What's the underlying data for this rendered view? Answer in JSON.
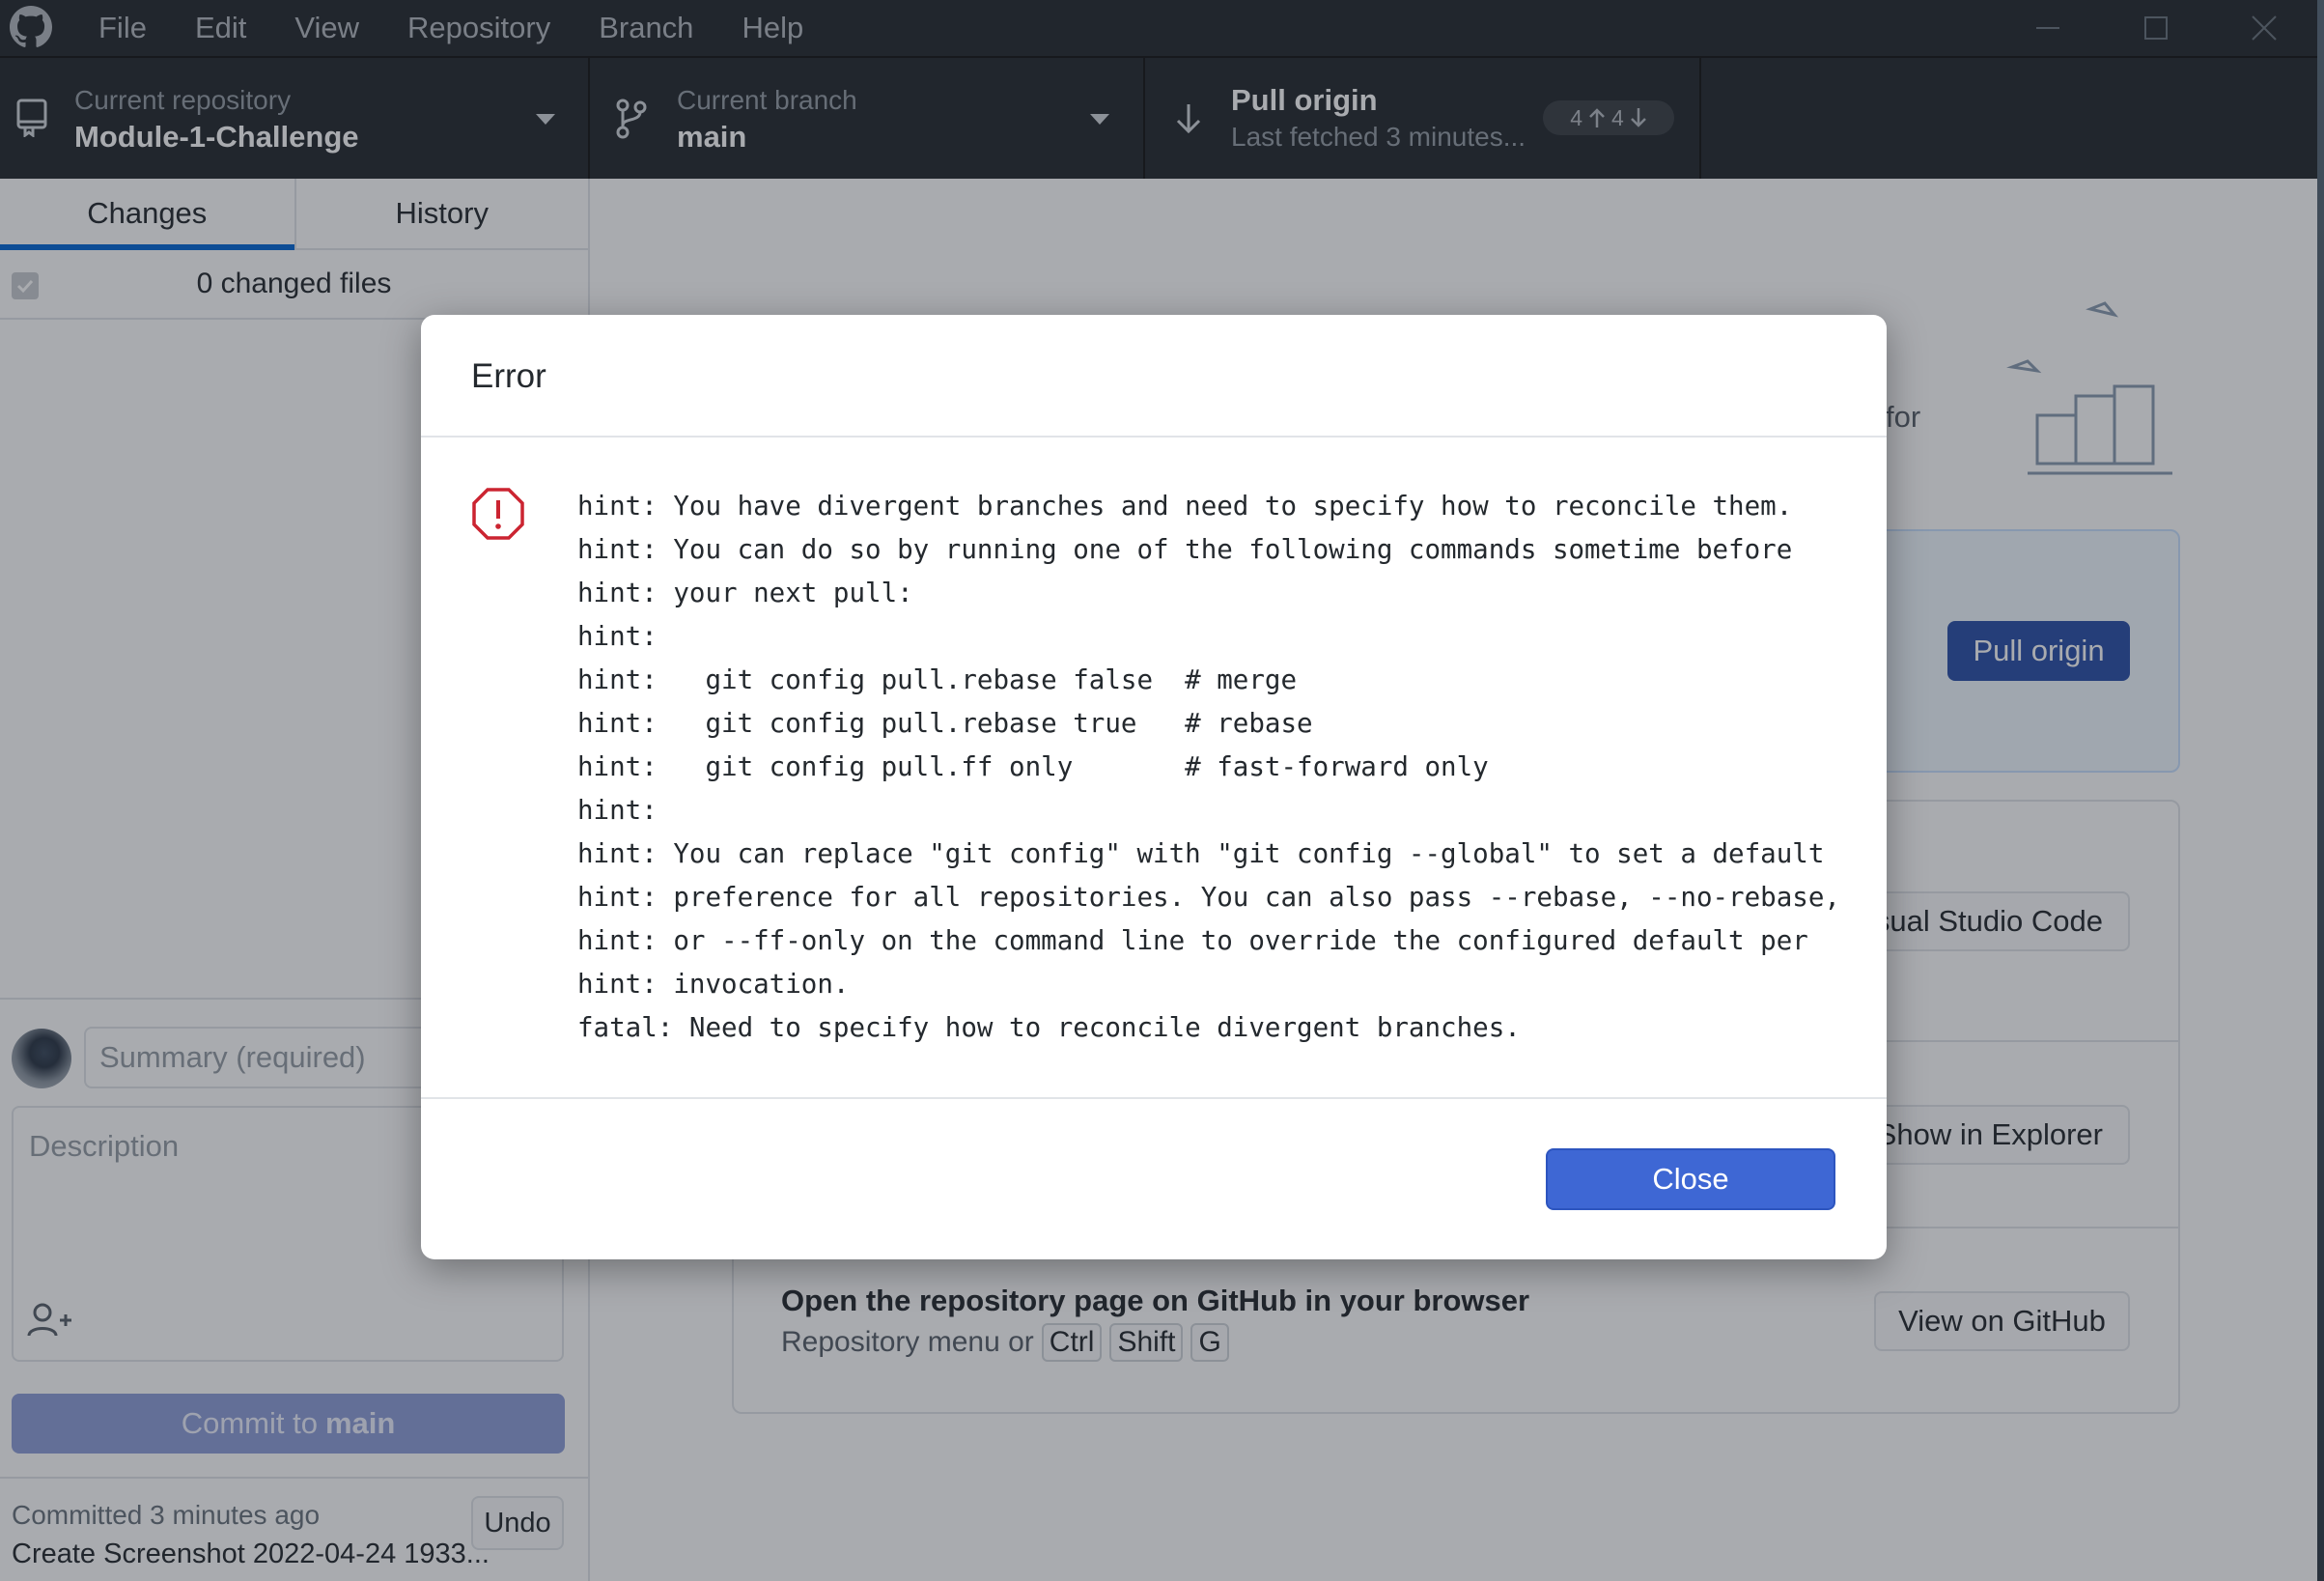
{
  "menu": [
    "File",
    "Edit",
    "View",
    "Repository",
    "Branch",
    "Help"
  ],
  "toolbar": {
    "repo_label": "Current repository",
    "repo_value": "Module-1-Challenge",
    "branch_label": "Current branch",
    "branch_value": "main",
    "pull_label": "Pull origin",
    "pull_sub": "Last fetched 3 minutes...",
    "ahead": "4",
    "behind": "4"
  },
  "sidebar": {
    "tabs": [
      "Changes",
      "History"
    ],
    "changed_files": "0 changed files",
    "summary_placeholder": "Summary (required)",
    "description_placeholder": "Description",
    "commit_prefix": "Commit to",
    "commit_branch": "main",
    "last_commit_when": "Committed 3 minutes ago",
    "last_commit_msg": "Create Screenshot 2022-04-24 1933...",
    "undo": "Undo"
  },
  "main": {
    "peek_text": "for",
    "pull_button": "Pull origin",
    "editor_button": "sual Studio Code",
    "explorer_button": "Show in Explorer",
    "github_title": "Open the repository page on GitHub in your browser",
    "github_sub": "Repository menu or",
    "github_keys": [
      "Ctrl",
      "Shift",
      "G"
    ],
    "github_button": "View on GitHub"
  },
  "dialog": {
    "title": "Error",
    "lines": [
      "hint: You have divergent branches and need to specify how to reconcile them.",
      "hint: You can do so by running one of the following commands sometime before",
      "hint: your next pull:",
      "hint:",
      "hint:   git config pull.rebase false  # merge",
      "hint:   git config pull.rebase true   # rebase",
      "hint:   git config pull.ff only       # fast-forward only",
      "hint:",
      "hint: You can replace \"git config\" with \"git config --global\" to set a default",
      "hint: preference for all repositories. You can also pass --rebase, --no-rebase,",
      "hint: or --ff-only on the command line to override the configured default per",
      "hint: invocation.",
      "fatal: Need to specify how to reconcile divergent branches."
    ],
    "close": "Close"
  },
  "colors": {
    "titlebar": "#24292e",
    "accent": "#3e67d4",
    "error": "#cb2431"
  }
}
